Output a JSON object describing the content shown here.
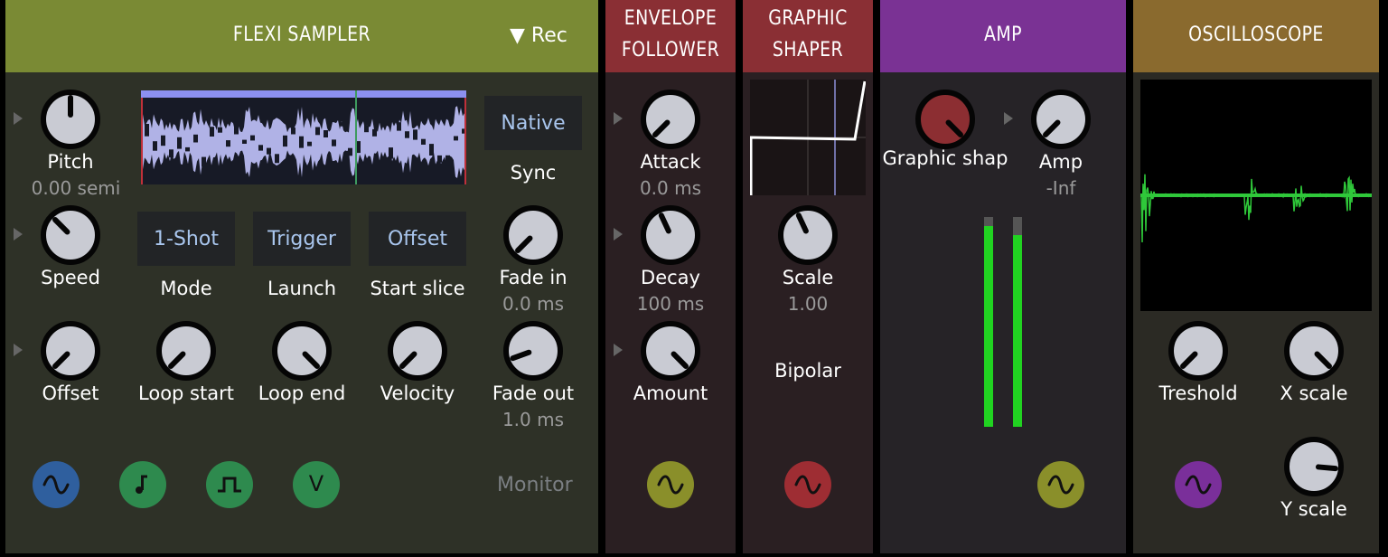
{
  "sampler": {
    "title": "FLEXI SAMPLER",
    "rec_label": "▼ Rec",
    "knobs": [
      {
        "label": "Pitch",
        "value": "0.00 semi"
      },
      {
        "label": "Speed",
        "value": ""
      },
      {
        "label": "Offset",
        "value": ""
      },
      {
        "label": "Loop start",
        "value": ""
      },
      {
        "label": "Loop end",
        "value": ""
      },
      {
        "label": "Velocity",
        "value": ""
      },
      {
        "label": "Fade in",
        "value": "0.0 ms"
      },
      {
        "label": "Fade out",
        "value": "1.0 ms"
      }
    ],
    "buttons": {
      "native": "Native",
      "sync": "Sync",
      "mode_value": "1-Shot",
      "mode_label": "Mode",
      "launch_value": "Trigger",
      "launch_label": "Launch",
      "start_value": "Offset",
      "start_label": "Start slice"
    },
    "monitor": "Monitor",
    "port_icons": [
      "sine-icon",
      "note-icon",
      "gate-icon",
      "velocity-icon"
    ],
    "port_colors": [
      "#2f5f9e",
      "#2e8a4e",
      "#2e8a4e",
      "#2e8a4e"
    ],
    "velocity_glyph": "V"
  },
  "envelope": {
    "title_line1": "ENVELOPE",
    "title_line2": "FOLLOWER",
    "knobs": [
      {
        "label": "Attack",
        "value": "0.0 ms"
      },
      {
        "label": "Decay",
        "value": "100 ms"
      },
      {
        "label": "Amount",
        "value": ""
      }
    ],
    "port_color": "#8a8f2a"
  },
  "shaper": {
    "title_line1": "GRAPHIC",
    "title_line2": "SHAPER",
    "scale_label": "Scale",
    "scale_value": "1.00",
    "bipolar": "Bipolar",
    "port_color": "#9e2d33"
  },
  "amp": {
    "title": "AMP",
    "graphic_label": "Graphic shap",
    "amp_label": "Amp",
    "amp_value": "-Inf",
    "port_color": "#8a8f2a"
  },
  "scope": {
    "title": "OSCILLOSCOPE",
    "treshold": "Treshold",
    "xscale": "X scale",
    "yscale": "Y scale",
    "port_color": "#7a2f9a"
  },
  "colors": {
    "sampler_header": "#7a8a34",
    "envelope_header": "#8a2f34",
    "shaper_header": "#8a2f34",
    "amp_header": "#7a3294",
    "scope_header": "#8a6a2e",
    "wave_fill": "#b0b2e6",
    "meter_green": "#21d321"
  }
}
